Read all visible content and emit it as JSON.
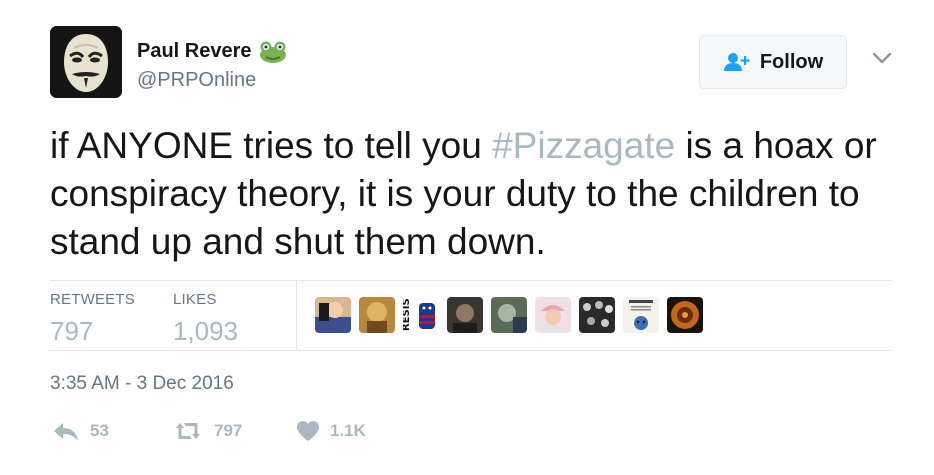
{
  "user": {
    "name": "Paul Revere",
    "handle": "@PRPOnline",
    "avatar_icon": "guy-fawkes-mask-avatar",
    "name_badge_icon": "frog-emoji-icon"
  },
  "follow_button": {
    "label": "Follow",
    "icon": "add-user-icon"
  },
  "menu_icon": "chevron-down-icon",
  "tweet": {
    "text_before": "if ANYONE tries to tell you ",
    "hashtag": "#Pizzagate",
    "text_after": " is a hoax or conspiracy theory, it is your duty to the children to stand up and shut them down."
  },
  "stats": {
    "retweets_label": "RETWEETS",
    "retweets_value": "797",
    "likes_label": "LIKES",
    "likes_value": "1,093"
  },
  "likers_count": 9,
  "timestamp": "3:35 AM - 3 Dec 2016",
  "actions": {
    "reply_count": "53",
    "retweet_count": "797",
    "like_count": "1.1K"
  },
  "colors": {
    "text": "#14171a",
    "secondary": "#657786",
    "muted": "#aab8c2",
    "link_blue": "#1da1f2",
    "divider": "#e1e8ed"
  }
}
